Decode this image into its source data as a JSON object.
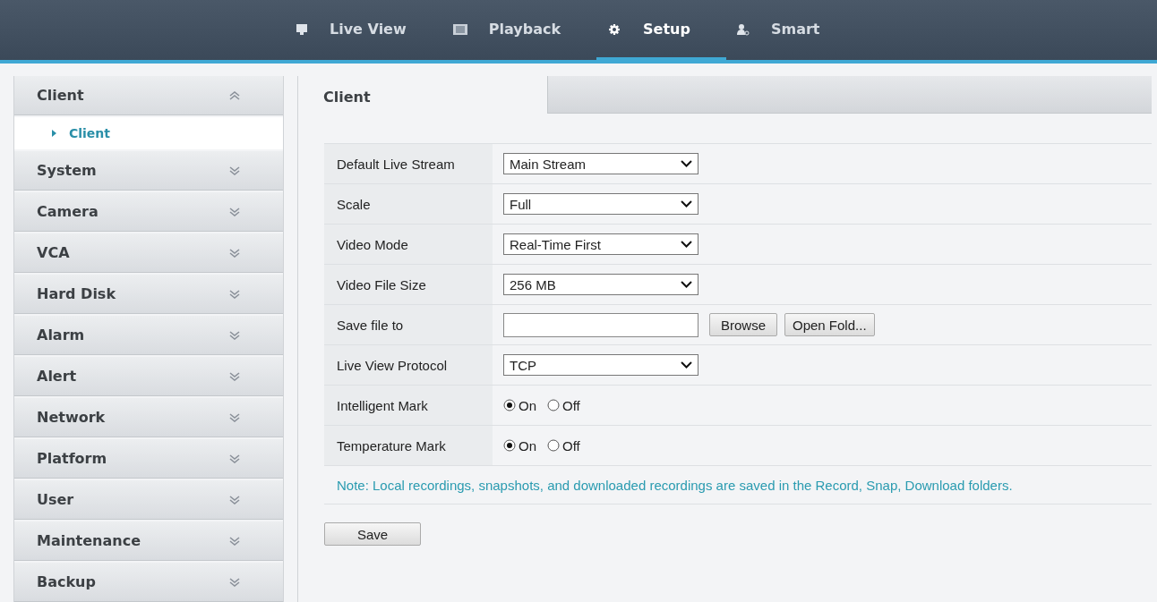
{
  "nav": [
    {
      "label": "Live View",
      "kind": "monitor",
      "selected": false
    },
    {
      "label": "Playback",
      "kind": "film",
      "selected": false
    },
    {
      "label": "Setup",
      "kind": "gear",
      "selected": true
    },
    {
      "label": "Smart",
      "kind": "person",
      "selected": false
    }
  ],
  "sidebar": {
    "items": [
      {
        "label": "Client",
        "expanded": true,
        "children": [
          {
            "label": "Client",
            "selected": true
          }
        ]
      },
      {
        "label": "System",
        "expanded": false
      },
      {
        "label": "Camera",
        "expanded": false
      },
      {
        "label": "VCA",
        "expanded": false
      },
      {
        "label": "Hard Disk",
        "expanded": false
      },
      {
        "label": "Alarm",
        "expanded": false
      },
      {
        "label": "Alert",
        "expanded": false
      },
      {
        "label": "Network",
        "expanded": false
      },
      {
        "label": "Platform",
        "expanded": false
      },
      {
        "label": "User",
        "expanded": false
      },
      {
        "label": "Maintenance",
        "expanded": false
      },
      {
        "label": "Backup",
        "expanded": false
      }
    ]
  },
  "tabs": [
    {
      "label": "Client",
      "selected": true
    }
  ],
  "form": {
    "rows": [
      {
        "kind": "select",
        "label": "Default Live Stream",
        "value": "Main Stream"
      },
      {
        "kind": "select",
        "label": "Scale",
        "value": "Full"
      },
      {
        "kind": "select",
        "label": "Video Mode",
        "value": "Real-Time First"
      },
      {
        "kind": "select",
        "label": "Video File Size",
        "value": "256 MB"
      },
      {
        "kind": "file",
        "label": "Save file to",
        "buttons": [
          "Browse",
          "Open Fold..."
        ]
      },
      {
        "kind": "select",
        "label": "Live View Protocol",
        "value": "TCP"
      },
      {
        "kind": "radio",
        "label": "Intelligent Mark",
        "options": [
          {
            "label": "On",
            "selected": true
          },
          {
            "label": "Off",
            "selected": false
          }
        ]
      },
      {
        "kind": "radio",
        "label": "Temperature Mark",
        "options": [
          {
            "label": "On",
            "selected": true
          },
          {
            "label": "Off",
            "selected": false
          }
        ]
      }
    ],
    "note": "Note: Local recordings, snapshots, and downloaded recordings are saved in the Record, Snap, Download folders."
  },
  "save_button": "Save"
}
